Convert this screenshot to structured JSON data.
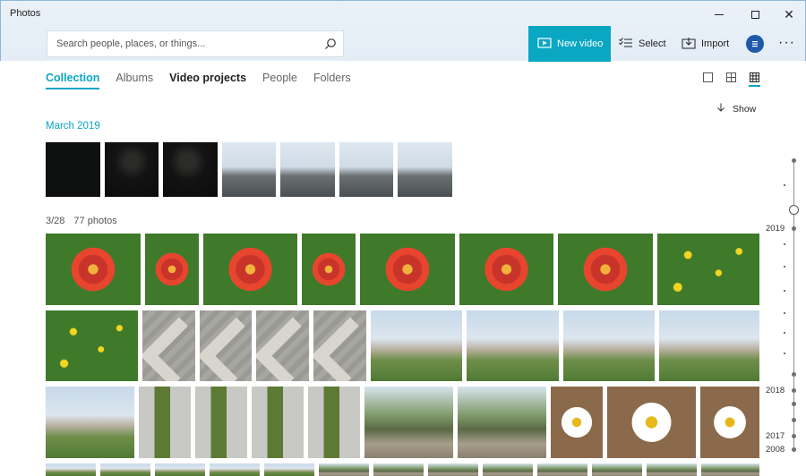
{
  "window": {
    "title": "Photos"
  },
  "search": {
    "placeholder": "Search people, places, or things..."
  },
  "toolbar": {
    "new_video": "New video",
    "select": "Select",
    "import": "Import"
  },
  "tabs": [
    {
      "label": "Collection"
    },
    {
      "label": "Albums"
    },
    {
      "label": "Video projects"
    },
    {
      "label": "People"
    },
    {
      "label": "Folders"
    }
  ],
  "show_label": "Show",
  "sections": [
    {
      "title": "March 2019"
    }
  ],
  "group": {
    "date": "3/28",
    "count": "77 photos"
  },
  "timeline": {
    "years": [
      "2019",
      "2018",
      "2017",
      "2008"
    ]
  },
  "colors": {
    "accent": "#0aa7c2",
    "profile": "#1e5aa8"
  },
  "icons": [
    "search-icon",
    "new-video-icon",
    "select-icon",
    "import-icon",
    "profile-icon",
    "more-icon",
    "single-view-icon",
    "medium-grid-icon",
    "small-grid-icon",
    "arrow-down-icon"
  ]
}
